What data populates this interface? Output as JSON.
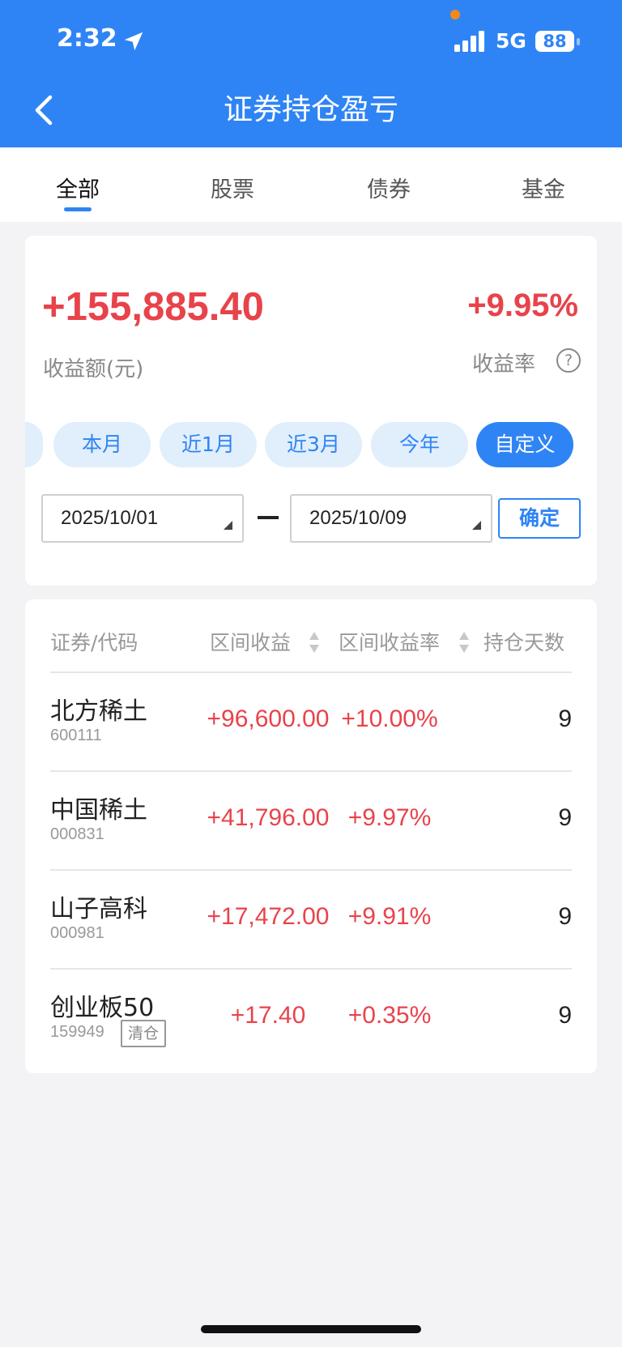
{
  "status_bar": {
    "time": "2:32",
    "network": "5G",
    "battery": "88"
  },
  "header": {
    "title": "证券持仓盈亏"
  },
  "tabs": [
    {
      "label": "全部",
      "active": true
    },
    {
      "label": "股票",
      "active": false
    },
    {
      "label": "债券",
      "active": false
    },
    {
      "label": "基金",
      "active": false
    }
  ],
  "summary": {
    "profit_amount": "+155,885.40",
    "profit_amount_label": "收益额(元)",
    "profit_rate": "+9.95%",
    "profit_rate_label": "收益率",
    "help_glyph": "?"
  },
  "periods": [
    {
      "label": "本月",
      "active": false
    },
    {
      "label": "近1月",
      "active": false
    },
    {
      "label": "近3月",
      "active": false
    },
    {
      "label": "今年",
      "active": false
    },
    {
      "label": "自定义",
      "active": true
    }
  ],
  "date_range": {
    "start": "2025/10/01",
    "end": "2025/10/09",
    "confirm_label": "确定"
  },
  "table": {
    "headers": {
      "name": "证券/代码",
      "profit": "区间收益",
      "rate": "区间收益率",
      "days": "持仓天数"
    },
    "rows": [
      {
        "name": "北方稀土",
        "code": "600111",
        "tag": "",
        "profit": "+96,600.00",
        "rate": "+10.00%",
        "days": "9"
      },
      {
        "name": "中国稀土",
        "code": "000831",
        "tag": "",
        "profit": "+41,796.00",
        "rate": "+9.97%",
        "days": "9"
      },
      {
        "name": "山子高科",
        "code": "000981",
        "tag": "",
        "profit": "+17,472.00",
        "rate": "+9.91%",
        "days": "9"
      },
      {
        "name": "创业板50",
        "code": "159949",
        "tag": "清仓",
        "profit": "+17.40",
        "rate": "+0.35%",
        "days": "9"
      }
    ]
  },
  "colors": {
    "primary": "#2f84f5",
    "positive": "#e8434b",
    "chip_bg": "#e1eefc"
  },
  "icons": [
    "location-arrow-icon",
    "signal-icon",
    "battery-icon",
    "back-chevron-icon",
    "help-icon",
    "sort-icon",
    "dropdown-caret-icon"
  ]
}
